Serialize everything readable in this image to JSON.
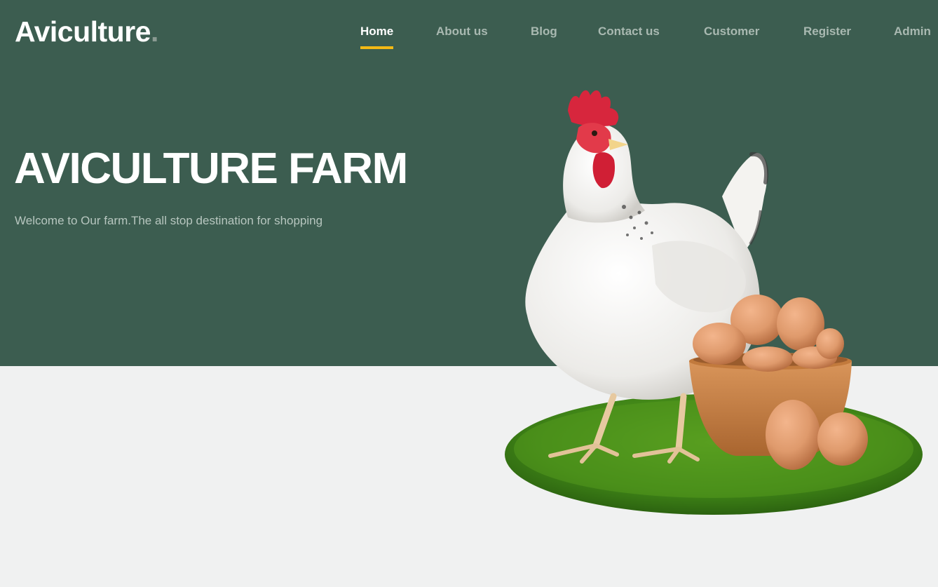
{
  "header": {
    "logo_text": "Aviculture",
    "logo_dot": "."
  },
  "nav": {
    "items": [
      {
        "label": "Home",
        "active": true
      },
      {
        "label": "About us",
        "active": false
      },
      {
        "label": "Blog",
        "active": false
      },
      {
        "label": "Contact us",
        "active": false
      },
      {
        "label": "Customer",
        "active": false
      },
      {
        "label": "Register",
        "active": false
      },
      {
        "label": "Admin",
        "active": false
      }
    ]
  },
  "hero": {
    "title": "AVICULTURE FARM",
    "subtitle": "Welcome to Our farm.The all stop destination for shopping",
    "image_subject": "white hen with basket of brown eggs on grass"
  },
  "colors": {
    "hero_background": "#3c5d50",
    "page_background": "#f0f1f1",
    "nav_active_underline": "#f3b915",
    "nav_inactive_text": "#a9b9b1"
  }
}
